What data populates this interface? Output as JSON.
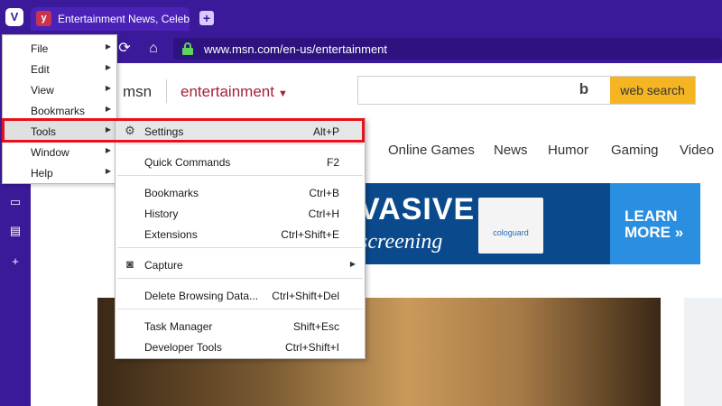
{
  "browser": {
    "tab_title": "Entertainment News, Celeb",
    "new_tab_symbol": "+",
    "url": "www.msn.com/en-us/entertainment"
  },
  "menu": {
    "items": [
      {
        "label": "File"
      },
      {
        "label": "Edit"
      },
      {
        "label": "View"
      },
      {
        "label": "Bookmarks"
      },
      {
        "label": "Tools"
      },
      {
        "label": "Window"
      },
      {
        "label": "Help"
      }
    ]
  },
  "tools_submenu": {
    "items": [
      {
        "label": "Settings",
        "shortcut": "Alt+P",
        "icon": "gear-icon"
      },
      {
        "label": "Quick Commands",
        "shortcut": "F2"
      },
      {
        "label": "Bookmarks",
        "shortcut": "Ctrl+B"
      },
      {
        "label": "History",
        "shortcut": "Ctrl+H"
      },
      {
        "label": "Extensions",
        "shortcut": "Ctrl+Shift+E"
      },
      {
        "label": "Capture",
        "shortcut": "",
        "icon": "camera-icon"
      },
      {
        "label": "Delete Browsing Data...",
        "shortcut": "Ctrl+Shift+Del"
      },
      {
        "label": "Task Manager",
        "shortcut": "Shift+Esc"
      },
      {
        "label": "Developer Tools",
        "shortcut": "Ctrl+Shift+I"
      }
    ]
  },
  "page": {
    "brand": "msn",
    "section": "entertainment",
    "search_button": "web search",
    "nav": [
      "Online Games",
      "News",
      "Humor",
      "Gaming",
      "Video"
    ],
    "ad": {
      "headline": "VASIVE",
      "subline": "screening",
      "product": "cologuard",
      "cta_line1": "LEARN",
      "cta_line2": "MORE"
    }
  },
  "colors": {
    "chrome": "#3b1a9a",
    "highlight": "#e8101a",
    "accent_section": "#a0243a",
    "search_button": "#f5b523"
  }
}
